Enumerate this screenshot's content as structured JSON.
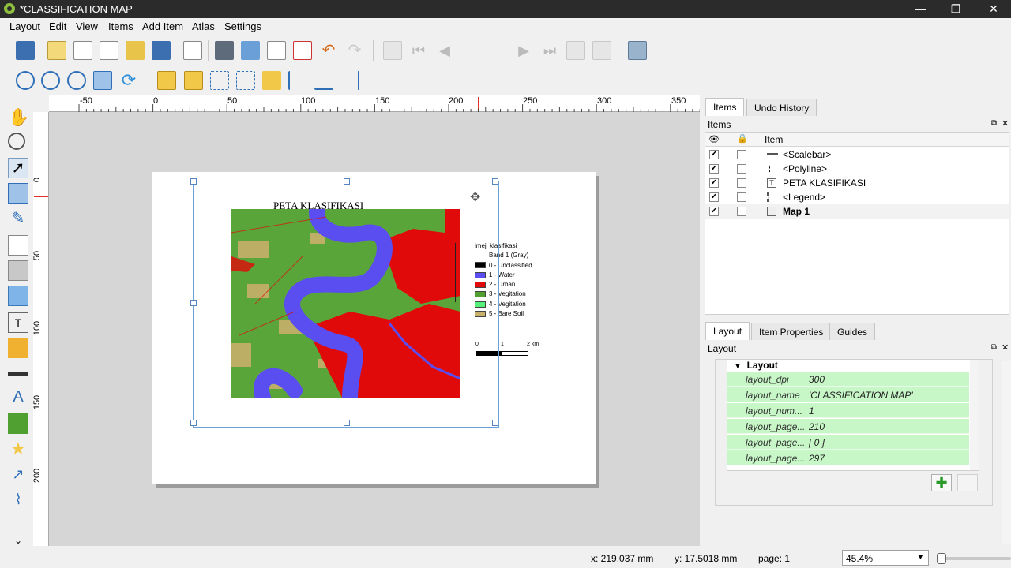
{
  "window": {
    "title": "*CLASSIFICATION MAP",
    "minimize": "—",
    "restore": "❐",
    "close": "✕"
  },
  "menu": [
    "Layout",
    "Edit",
    "View",
    "Items",
    "Add Item",
    "Atlas",
    "Settings"
  ],
  "toolbar": {
    "page_number": "1"
  },
  "ruler": {
    "h_ticks": [
      "-50",
      "0",
      "50",
      "100",
      "150",
      "200",
      "250",
      "300",
      "350"
    ],
    "v_ticks": [
      "0",
      "50",
      "100",
      "150",
      "200"
    ]
  },
  "map_layout": {
    "title": "PETA KLASIFIKASI",
    "legend": {
      "layer": "imej_klasifikasi",
      "band": "Band 1 (Gray)",
      "entries": [
        {
          "label": "0 - Unclassified",
          "color": "#000000"
        },
        {
          "label": "1 - Water",
          "color": "#5a4ef0"
        },
        {
          "label": "2 - Urban",
          "color": "#e00a0a"
        },
        {
          "label": "3 - Vegitation",
          "color": "#4fa030"
        },
        {
          "label": "4 - Vegitation",
          "color": "#55f07a"
        },
        {
          "label": "5 - Bare Soil",
          "color": "#c8b06a"
        }
      ]
    },
    "scalebar": {
      "labels": [
        "0",
        "1",
        "2 km"
      ]
    }
  },
  "right_panel": {
    "top_tabs": [
      "Items",
      "Undo History"
    ],
    "items_title": "Items",
    "item_column": "Item",
    "items": [
      {
        "name": "<Scalebar>",
        "icon": "scalebar-icon",
        "checked": true,
        "bold": false
      },
      {
        "name": "<Polyline>",
        "icon": "polyline-icon",
        "checked": true,
        "bold": false
      },
      {
        "name": "PETA KLASIFIKASI",
        "icon": "text-icon",
        "checked": true,
        "bold": false
      },
      {
        "name": "<Legend>",
        "icon": "legend-icon",
        "checked": true,
        "bold": false
      },
      {
        "name": "Map 1",
        "icon": "map-icon",
        "checked": true,
        "bold": true
      }
    ],
    "bottom_tabs": [
      "Layout",
      "Item Properties",
      "Guides"
    ],
    "layout_title": "Layout",
    "group_label": "Layout",
    "properties": [
      {
        "key": "layout_dpi",
        "value": "300"
      },
      {
        "key": "layout_name",
        "value": "'CLASSIFICATION MAP'"
      },
      {
        "key": "layout_num...",
        "value": "1"
      },
      {
        "key": "layout_page...",
        "value": "210"
      },
      {
        "key": "layout_page...",
        "value": "[ 0 ]"
      },
      {
        "key": "layout_page...",
        "value": "297"
      }
    ]
  },
  "status": {
    "x": "x: 219.037 mm",
    "y": "y: 17.5018 mm",
    "page": "page: 1",
    "zoom": "45.4%"
  },
  "colors": {
    "water": "#5a4ef0",
    "urban": "#e00a0a",
    "vegetation": "#4fa030",
    "bare_soil": "#c8b06a",
    "selection": "#6aa0d8",
    "property_row": "#c7f7c7"
  }
}
